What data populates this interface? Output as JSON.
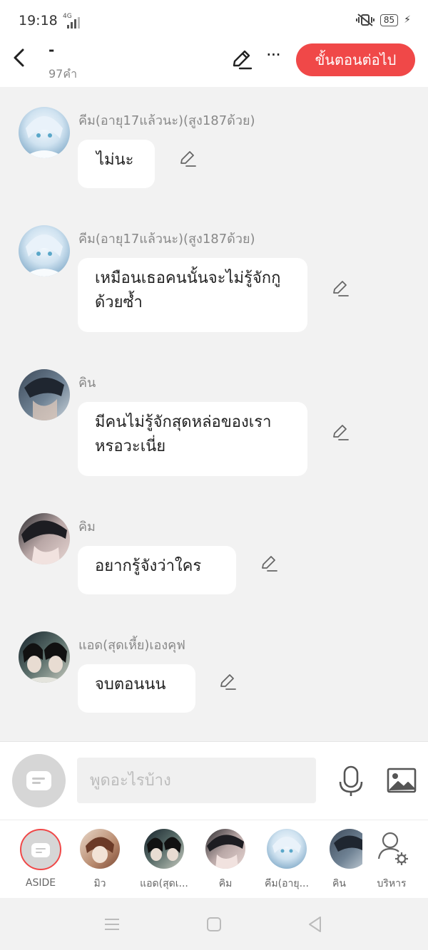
{
  "status_bar": {
    "time": "19:18",
    "network": "4G",
    "battery": "85"
  },
  "header": {
    "title": "-",
    "word_count": "97คำ",
    "next_button": "ขั้นตอนต่อไป",
    "more_label": "···"
  },
  "messages": [
    {
      "sender": "คีม(อายุ17แล้วนะ)(สูง187ด้วย)",
      "text": "ไม่นะ",
      "avatar": "kim-avatar"
    },
    {
      "sender": "คีม(อายุ17แล้วนะ)(สูง187ด้วย)",
      "text": "เหมือนเธอคนนั้นจะไม่รู้จักกูด้วยซ้ำ",
      "avatar": "kim-avatar"
    },
    {
      "sender": "คิน",
      "text": "มีคนไม่รู้จักสุดหล่อของเราหรอวะเนี่ย",
      "avatar": "kin-avatar"
    },
    {
      "sender": "คิม",
      "text": "อยากรู้จังว่าใคร",
      "avatar": "kim2-avatar"
    },
    {
      "sender": "แอด(สุดเหี้ย)เองคุฟ",
      "text": "จบตอนนน",
      "avatar": "ad-avatar"
    }
  ],
  "input": {
    "placeholder": "พูดอะไรบ้าง"
  },
  "characters": [
    {
      "name": "ASIDE"
    },
    {
      "name": "มิว"
    },
    {
      "name": "แอด(สุดเ..."
    },
    {
      "name": "คิม"
    },
    {
      "name": "คีม(อายุ..."
    },
    {
      "name": "คิน"
    },
    {
      "name": "บริหาร"
    }
  ],
  "colors": {
    "accent": "#f04848",
    "background": "#f2f2f2",
    "bubble": "#ffffff"
  }
}
